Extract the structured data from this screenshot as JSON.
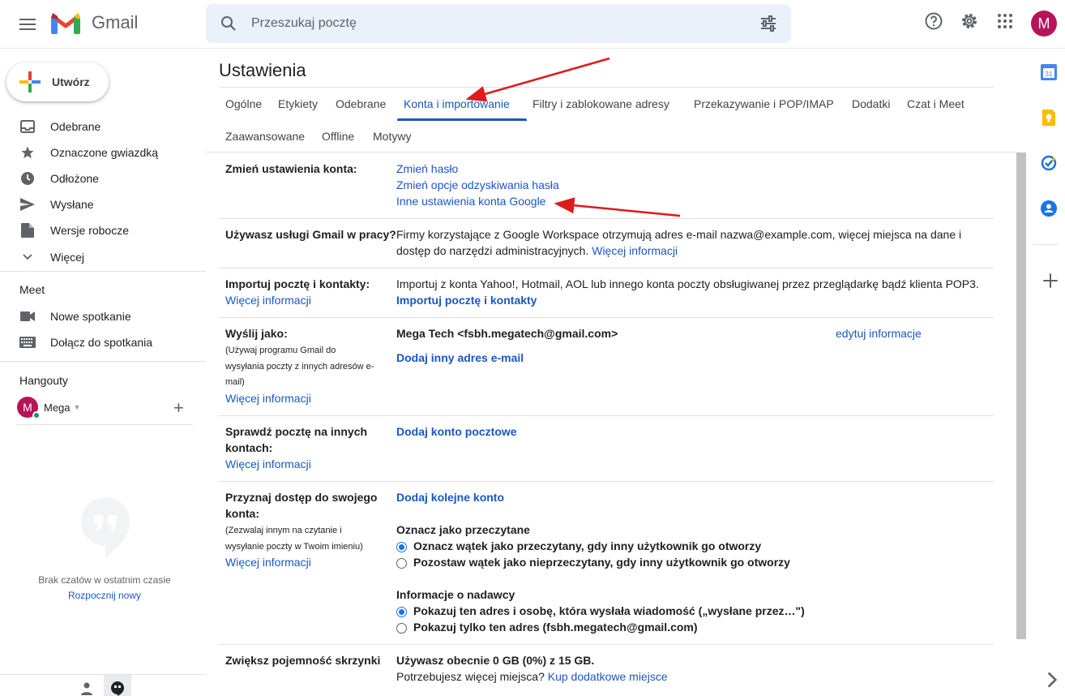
{
  "header": {
    "app_name": "Gmail",
    "search_placeholder": "Przeszukaj pocztę",
    "avatar_letter": "M"
  },
  "sidebar": {
    "compose_label": "Utwórz",
    "items": [
      {
        "label": "Odebrane",
        "icon": "inbox-icon"
      },
      {
        "label": "Oznaczone gwiazdką",
        "icon": "star-icon"
      },
      {
        "label": "Odłożone",
        "icon": "clock-icon"
      },
      {
        "label": "Wysłane",
        "icon": "send-icon"
      },
      {
        "label": "Wersje robocze",
        "icon": "draft-icon"
      },
      {
        "label": "Więcej",
        "icon": "chevron-down-icon"
      }
    ],
    "meet": {
      "title": "Meet",
      "items": [
        {
          "label": "Nowe spotkanie",
          "icon": "videocam-icon"
        },
        {
          "label": "Dołącz do spotkania",
          "icon": "keyboard-icon"
        }
      ]
    },
    "hangouts": {
      "title": "Hangouty",
      "user_letter": "M",
      "user_name": "Mega",
      "no_chats": "Brak czatów w ostatnim czasie",
      "start_new": "Rozpocznij nowy"
    }
  },
  "settings": {
    "title": "Ustawienia",
    "tabs": [
      {
        "label": "Ogólne"
      },
      {
        "label": "Etykiety"
      },
      {
        "label": "Odebrane"
      },
      {
        "label": "Konta i importowanie",
        "active": true
      },
      {
        "label": "Filtry i zablokowane adresy"
      },
      {
        "label": "Przekazywanie i POP/IMAP"
      },
      {
        "label": "Dodatki"
      },
      {
        "label": "Czat i Meet"
      },
      {
        "label": "Zaawansowane"
      },
      {
        "label": "Offline"
      },
      {
        "label": "Motywy"
      }
    ],
    "change_account": {
      "label": "Zmień ustawienia konta:",
      "links": [
        "Zmień hasło",
        "Zmień opcje odzyskiwania hasła",
        "Inne ustawienia konta Google"
      ]
    },
    "workspace": {
      "label": "Używasz usługi Gmail w pracy?",
      "text1": "Firmy korzystające z Google Workspace otrzymują adres e-mail nazwa@example.com, więcej miejsca na dane i",
      "text2": "dostęp do narzędzi administracyjnych.",
      "more": "Więcej informacji"
    },
    "import": {
      "label": "Importuj pocztę i kontakty:",
      "more": "Więcej informacji",
      "text": "Importuj z konta Yahoo!, Hotmail, AOL lub innego konta poczty obsługiwanej przez przeglądarkę bądź klienta POP3.",
      "action": "Importuj pocztę i kontakty"
    },
    "send_as": {
      "label": "Wyślij jako:",
      "note1": "(Używaj programu Gmail do",
      "note2": "wysyłania poczty z innych adresów e-",
      "note3": "mail)",
      "more": "Więcej informacji",
      "identity": "Mega Tech <fsbh.megatech@gmail.com>",
      "edit": "edytuj informacje",
      "add": "Dodaj inny adres e-mail"
    },
    "check_mail": {
      "label1": "Sprawdź pocztę na innych",
      "label2": "kontach:",
      "more": "Więcej informacji",
      "add": "Dodaj konto pocztowe"
    },
    "grant_access": {
      "label1": "Przyznaj dostęp do swojego",
      "label2": "konta:",
      "note1": "(Zezwalaj innym na czytanie i",
      "note2": "wysyłanie poczty w Twoim imieniu)",
      "more": "Więcej informacji",
      "add": "Dodaj kolejne konto",
      "mark_read_title": "Oznacz jako przeczytane",
      "mark_read_opt1": "Oznacz wątek jako przeczytany, gdy inny użytkownik go otworzy",
      "mark_read_opt2": "Pozostaw wątek jako nieprzeczytany, gdy inny użytkownik go otworzy",
      "sender_title": "Informacje o nadawcy",
      "sender_opt1": "Pokazuj ten adres i osobę, która wysłała wiadomość („wysłane przez…\")",
      "sender_opt2": "Pokazuj tylko ten adres (fsbh.megatech@gmail.com)"
    },
    "storage": {
      "label": "Zwiększ pojemność skrzynki",
      "usage": "Używasz obecnie 0 GB (0%) z 15 GB.",
      "need_more": "Potrzebujesz więcej miejsca?",
      "buy": "Kup dodatkowe miejsce"
    }
  },
  "colors": {
    "link": "#1a57c2",
    "accent": "#1a73e8",
    "annotation_arrow": "#e0191b",
    "avatar": "#b5145a"
  }
}
